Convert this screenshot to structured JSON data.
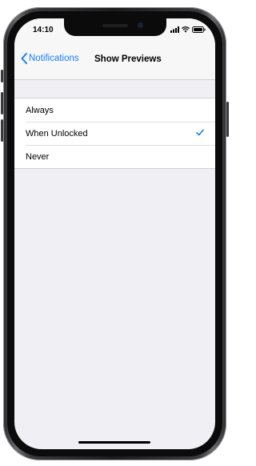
{
  "status_bar": {
    "time": "14:10",
    "icons": [
      "signal-icon",
      "wifi-icon",
      "battery-icon"
    ]
  },
  "nav": {
    "back_label": "Notifications",
    "title": "Show Previews"
  },
  "options": [
    {
      "label": "Always",
      "selected": false
    },
    {
      "label": "When Unlocked",
      "selected": true
    },
    {
      "label": "Never",
      "selected": false
    }
  ],
  "colors": {
    "accent": "#147efb",
    "background": "#efeff4",
    "bar": "#f7f7f7"
  }
}
